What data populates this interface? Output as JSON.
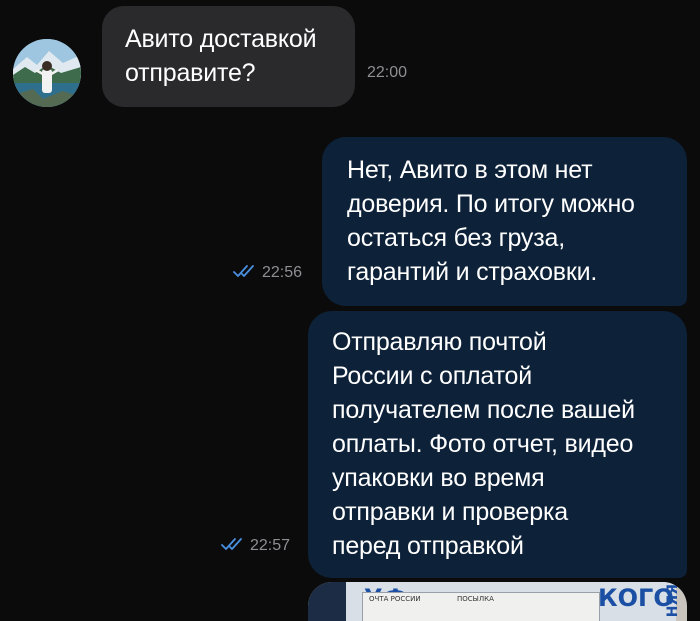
{
  "messages": [
    {
      "direction": "incoming",
      "lines": [
        "Авито доставкой",
        "отправите?"
      ],
      "time": "22:00"
    },
    {
      "direction": "outgoing",
      "lines": [
        "Нет, Авито в этом нет",
        "доверия. По итогу можно",
        "остаться без груза,",
        "гарантий и страховки."
      ],
      "time": "22:56",
      "status": "read"
    },
    {
      "direction": "outgoing",
      "lines": [
        "Отправляю почтой",
        "России с оплатой",
        "получателем после вашей",
        "оплаты. Фото отчет, видео",
        "упаковки во время",
        "отправки и проверка",
        "перед отправкой"
      ],
      "time": "22:57",
      "status": "read"
    }
  ],
  "photo": {
    "tape_text": "УФ",
    "tape_text_end": "КОГО",
    "label_left": "ОЧТА РОССИИ",
    "label_right": "ПОСЫЛКА",
    "side_text": "НЯЯ"
  },
  "colors": {
    "background": "#0b0b0c",
    "incoming_bubble": "#2a2a2c",
    "outgoing_bubble": "#0d2138",
    "read_ticks": "#4a90e2",
    "timestamp": "#8e8e93"
  }
}
